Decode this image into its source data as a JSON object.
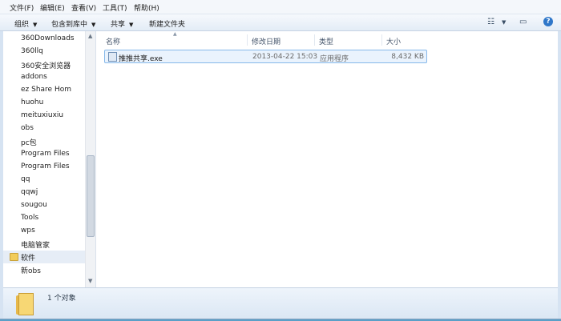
{
  "menubar": {
    "items": [
      "文件(F)",
      "编辑(E)",
      "查看(V)",
      "工具(T)",
      "帮助(H)"
    ]
  },
  "toolbar": {
    "organize": "组织",
    "include_in_library": "包含到库中",
    "share": "共享",
    "new_folder": "新建文件夹",
    "view_icon": "view-options-icon",
    "preview_icon": "preview-pane-icon",
    "help_icon": "help-icon",
    "help_glyph": "?"
  },
  "nav": {
    "items": [
      {
        "label": "360Downloads"
      },
      {
        "label": "360llq"
      },
      {
        "label": "360安全浏览器"
      },
      {
        "label": "addons"
      },
      {
        "label": "ez Share Hom"
      },
      {
        "label": "huohu"
      },
      {
        "label": "meituxiuxiu"
      },
      {
        "label": "obs"
      },
      {
        "label": "pc包"
      },
      {
        "label": "Program Files"
      },
      {
        "label": "Program Files"
      },
      {
        "label": "qq"
      },
      {
        "label": "qqwj"
      },
      {
        "label": "sougou"
      },
      {
        "label": "Tools"
      },
      {
        "label": "wps"
      },
      {
        "label": "电脑管家"
      },
      {
        "label": "软件",
        "selected": true
      },
      {
        "label": "新obs"
      }
    ]
  },
  "columns": {
    "name": "名称",
    "modified": "修改日期",
    "type": "类型",
    "size": "大小"
  },
  "files": [
    {
      "name": "推推共享.exe",
      "modified": "2013-04-22 15:03",
      "type": "应用程序",
      "size": "8,432 KB"
    }
  ],
  "status": {
    "count_text": "1 个对象"
  },
  "colors": {
    "selection": "#eaf3fd",
    "selection_border": "#86b8ea",
    "folder": "#f2cc5a"
  }
}
